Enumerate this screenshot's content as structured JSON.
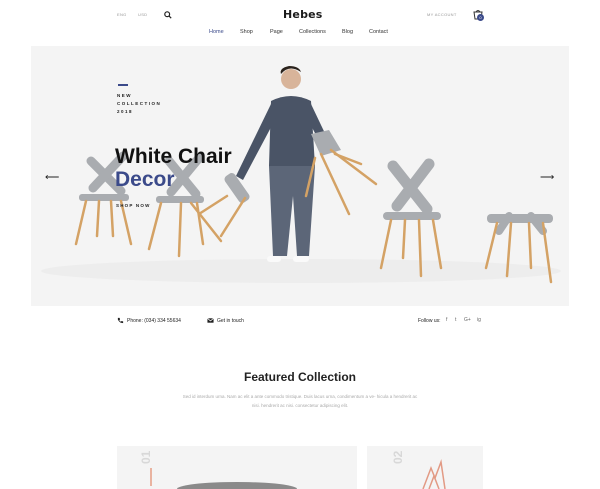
{
  "header": {
    "language": "ENG",
    "currency": "USD",
    "logo": "Hebes",
    "account": "MY ACCOUNT",
    "cart_count": "0"
  },
  "nav": {
    "items": [
      {
        "label": "Home",
        "active": true
      },
      {
        "label": "Shop",
        "active": false
      },
      {
        "label": "Page",
        "active": false
      },
      {
        "label": "Collections",
        "active": false
      },
      {
        "label": "Blog",
        "active": false
      },
      {
        "label": "Contact",
        "active": false
      }
    ]
  },
  "hero": {
    "tag_line1": "NEW",
    "tag_line2": "COLLECTION",
    "tag_line3": "2018",
    "title_line1": "White Chair",
    "title_line2": "Decor",
    "cta": "SHOP NOW",
    "prev_arrow": "⟵",
    "next_arrow": "⟶"
  },
  "info_bar": {
    "phone": "Phone: (034) 334 55634",
    "contact": "Get in touch",
    "follow_label": "Follow us:",
    "socials": [
      "f",
      "t",
      "G+",
      "ig"
    ]
  },
  "featured": {
    "title": "Featured Collection",
    "description": "Sed id interdum urna. Nam ac elit a ante commodo tristique. Duis lacus urna, condimentum a ve- hicula a hendrerit ac nisi. hendrerit ac nisi. consectetur adipiscing elit.",
    "cards": [
      {
        "number": "01"
      },
      {
        "number": "02"
      }
    ]
  },
  "colors": {
    "accent": "#3b4a8a",
    "hero_bg": "#f4f4f4",
    "chair_seat": "#a9acb0",
    "chair_leg": "#d4a265"
  },
  "icons": {
    "search": "search-icon",
    "cart": "cart-icon",
    "phone": "phone-icon",
    "mail": "mail-icon"
  }
}
